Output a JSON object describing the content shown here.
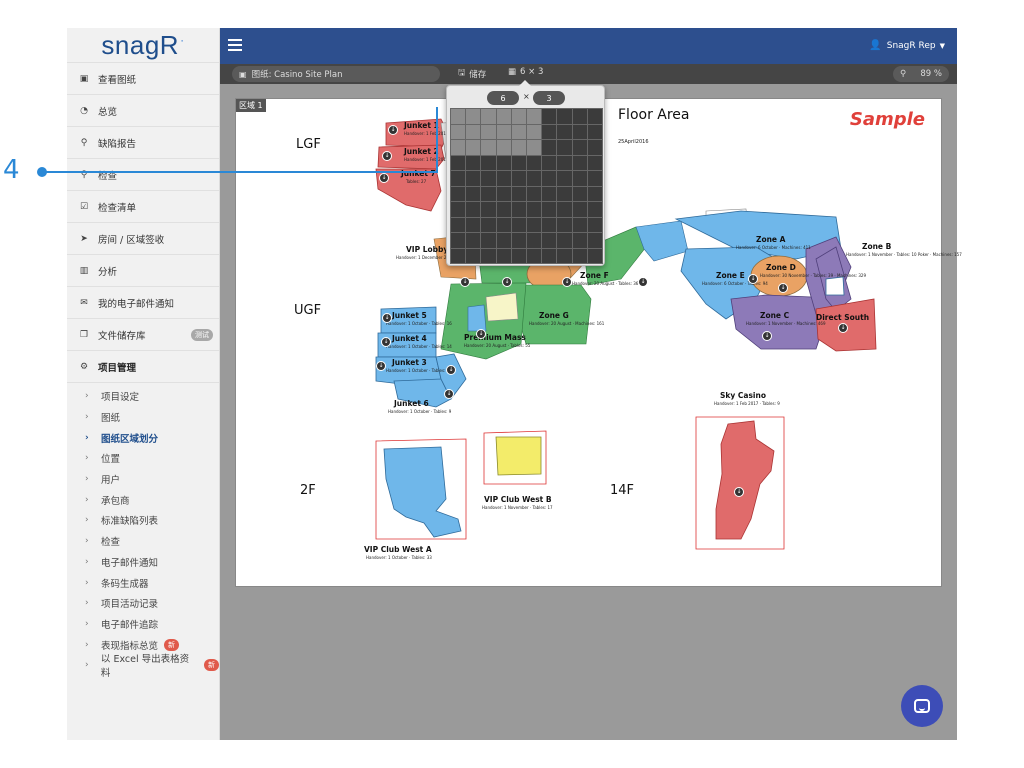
{
  "logo": "snagR",
  "sidebar": {
    "items": [
      {
        "label": "查看图纸",
        "icon": "image-icon"
      },
      {
        "label": "总览",
        "icon": "dashboard-icon"
      },
      {
        "label": "缺陷报告",
        "icon": "map-marker-icon"
      },
      {
        "label": "检查",
        "icon": "search-icon"
      },
      {
        "label": "检查清单",
        "icon": "checklist-icon"
      },
      {
        "label": "房间 / 区域签收",
        "icon": "location-arrow-icon"
      },
      {
        "label": "分析",
        "icon": "bar-chart-icon"
      },
      {
        "label": "我的电子邮件通知",
        "icon": "envelope-icon"
      },
      {
        "label": "文件储存库",
        "icon": "copy-icon",
        "badge": "测试"
      }
    ],
    "project_header": "项目管理",
    "project_items": [
      {
        "label": "项目设定"
      },
      {
        "label": "图纸"
      },
      {
        "label": "图纸区域划分",
        "active": true
      },
      {
        "label": "位置"
      },
      {
        "label": "用户"
      },
      {
        "label": "承包商"
      },
      {
        "label": "标准缺陷列表"
      },
      {
        "label": "检查"
      },
      {
        "label": "电子邮件通知"
      },
      {
        "label": "条码生成器"
      },
      {
        "label": "项目活动记录"
      },
      {
        "label": "电子邮件追踪"
      },
      {
        "label": "表现指标总览",
        "badge": "新"
      },
      {
        "label": "以 Excel 导出表格资料",
        "badge": "新"
      }
    ]
  },
  "topbar": {
    "user": "SnagR Rep"
  },
  "toolbar": {
    "plan_label": "图纸: Casino Site Plan",
    "save_label": "储存",
    "grid_label": "6 × 3",
    "zoom_value": "89 %"
  },
  "grid_popup": {
    "cols": "6",
    "rows": "3",
    "x": "×",
    "cols_selected": 6,
    "rows_selected": 3,
    "grid_size": 10
  },
  "sheet": {
    "area_tag": "区域 1",
    "title": "Floor Area",
    "date": "25April2016",
    "sample": "Sample",
    "levels": [
      "LGF",
      "UGF",
      "2F",
      "14F"
    ],
    "zones": [
      {
        "name": "Junket 1",
        "sub": "Handover: 1 Feb 2017 · Tables: 16"
      },
      {
        "name": "Junket 2",
        "sub": "Handover: 1 Feb 2017 · Tables: 17"
      },
      {
        "name": "Junket 7",
        "sub": "Tables: 27"
      },
      {
        "name": "VIP Lobby",
        "sub": "Handover: 1 December 2016"
      },
      {
        "name": "Zone A",
        "sub": "Handover: 6 October · Machines: 411"
      },
      {
        "name": "Zone B",
        "sub": "Handover: 1 November · Tables: 10 Poker · Machines: 157"
      },
      {
        "name": "Zone D",
        "sub": "Handover: 30 November · Tables: 39 · Machines: 329"
      },
      {
        "name": "Zone E",
        "sub": "Handover: 6 October · Tables: 94"
      },
      {
        "name": "Zone C",
        "sub": "Handover: 1 November · Machines: 469"
      },
      {
        "name": "Direct South",
        "sub": ""
      },
      {
        "name": "Zone F",
        "sub": "Handover: 20 August · Tables: 36"
      },
      {
        "name": "Zone G",
        "sub": "Handover: 20 August · Machines: 161"
      },
      {
        "name": "Premium Mass",
        "sub": "Handover: 20 August · Tables: 55"
      },
      {
        "name": "Junket 5",
        "sub": "Handover: 1 October · Tables: 16"
      },
      {
        "name": "Junket 4",
        "sub": "Handover: 1 October · Tables: 14"
      },
      {
        "name": "Junket 3",
        "sub": "Handover: 1 October · Tables: 21"
      },
      {
        "name": "Junket 6",
        "sub": "Handover: 1 October · Tables: 9"
      },
      {
        "name": "Sky Casino",
        "sub": "Handover: 1 Feb 2017 · Tables: 9"
      },
      {
        "name": "VIP Club West B",
        "sub": "Handover: 1 November · Tables: 17"
      },
      {
        "name": "VIP Club West A",
        "sub": "Handover: 1 October · Tables: 33"
      }
    ]
  },
  "callout": "4",
  "colors": {
    "topbar": "#2d4f8e",
    "accent": "#2a88d6",
    "zone_red": "#e06b6b",
    "zone_blue": "#6fb7ea",
    "zone_green": "#5bb56b",
    "zone_orange": "#e9a264",
    "zone_purple": "#8d7ab8",
    "zone_yellow": "#f3ec6a"
  }
}
